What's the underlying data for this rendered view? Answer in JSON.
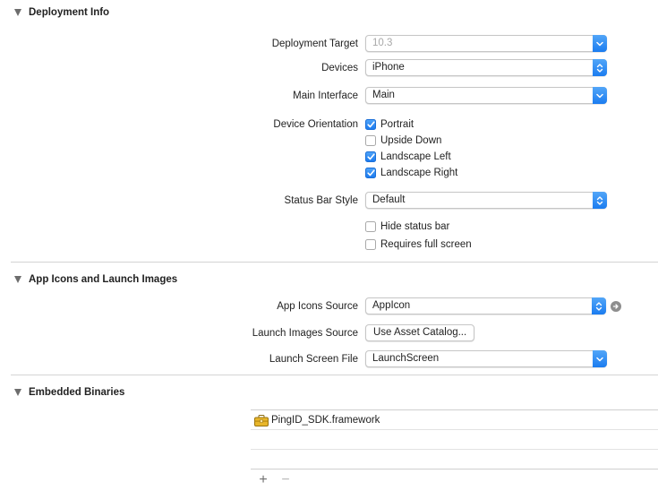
{
  "deployment": {
    "title": "Deployment Info",
    "target_label": "Deployment Target",
    "target_value": "10.3",
    "devices_label": "Devices",
    "devices_value": "iPhone",
    "main_interface_label": "Main Interface",
    "main_interface_value": "Main",
    "orientation_label": "Device Orientation",
    "orientations": [
      {
        "label": "Portrait",
        "checked": true
      },
      {
        "label": "Upside Down",
        "checked": false
      },
      {
        "label": "Landscape Left",
        "checked": true
      },
      {
        "label": "Landscape Right",
        "checked": true
      }
    ],
    "status_bar_label": "Status Bar Style",
    "status_bar_value": "Default",
    "hide_status_bar": {
      "label": "Hide status bar",
      "checked": false
    },
    "requires_full_screen": {
      "label": "Requires full screen",
      "checked": false
    }
  },
  "app_icons": {
    "title": "App Icons and Launch Images",
    "icons_source_label": "App Icons Source",
    "icons_source_value": "AppIcon",
    "launch_images_label": "Launch Images Source",
    "launch_images_button": "Use Asset Catalog...",
    "launch_screen_label": "Launch Screen File",
    "launch_screen_value": "LaunchScreen"
  },
  "embedded": {
    "title": "Embedded Binaries",
    "items": [
      "PingID_SDK.framework"
    ],
    "add_label": "+",
    "remove_label": "−"
  },
  "colors": {
    "accent": "#1b7cf0",
    "divider": "#d4d4d4"
  },
  "icons": {
    "disclosure": "disclosure-triangle-icon",
    "popup_arrow": "chevron-down-icon",
    "stepper_arrow": "up-down-chevron-icon",
    "goto": "arrow-circle-right-icon",
    "framework": "toolbox-icon",
    "checkmark": "checkmark-icon"
  }
}
